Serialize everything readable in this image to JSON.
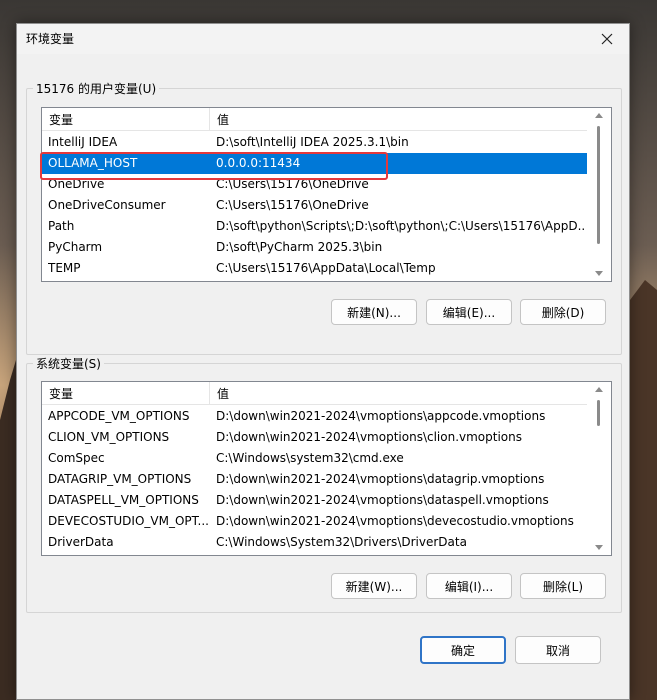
{
  "window": {
    "title": "环境变量",
    "close_icon": "close-icon"
  },
  "user_vars": {
    "group_label": "15176 的用户变量(U)",
    "columns": [
      "变量",
      "值"
    ],
    "rows": [
      {
        "name": "IntelliJ IDEA",
        "value": "D:\\soft\\IntelliJ IDEA 2025.3.1\\bin"
      },
      {
        "name": "OLLAMA_HOST",
        "value": "0.0.0.0:11434"
      },
      {
        "name": "OneDrive",
        "value": "C:\\Users\\15176\\OneDrive"
      },
      {
        "name": "OneDriveConsumer",
        "value": "C:\\Users\\15176\\OneDrive"
      },
      {
        "name": "Path",
        "value": "D:\\soft\\python\\Scripts\\;D:\\soft\\python\\;C:\\Users\\15176\\AppD..."
      },
      {
        "name": "PyCharm",
        "value": "D:\\soft\\PyCharm 2025.3\\bin"
      },
      {
        "name": "TEMP",
        "value": "C:\\Users\\15176\\AppData\\Local\\Temp"
      }
    ],
    "selected_row": "OLLAMA_HOST",
    "buttons": {
      "new": "新建(N)...",
      "edit": "编辑(E)...",
      "delete": "删除(D)"
    }
  },
  "system_vars": {
    "group_label": "系统变量(S)",
    "columns": [
      "变量",
      "值"
    ],
    "rows": [
      {
        "name": "APPCODE_VM_OPTIONS",
        "value": "D:\\down\\win2021-2024\\vmoptions\\appcode.vmoptions"
      },
      {
        "name": "CLION_VM_OPTIONS",
        "value": "D:\\down\\win2021-2024\\vmoptions\\clion.vmoptions"
      },
      {
        "name": "ComSpec",
        "value": "C:\\Windows\\system32\\cmd.exe"
      },
      {
        "name": "DATAGRIP_VM_OPTIONS",
        "value": "D:\\down\\win2021-2024\\vmoptions\\datagrip.vmoptions"
      },
      {
        "name": "DATASPELL_VM_OPTIONS",
        "value": "D:\\down\\win2021-2024\\vmoptions\\dataspell.vmoptions"
      },
      {
        "name": "DEVECOSTUDIO_VM_OPT...",
        "value": "D:\\down\\win2021-2024\\vmoptions\\devecostudio.vmoptions"
      },
      {
        "name": "DriverData",
        "value": "C:\\Windows\\System32\\Drivers\\DriverData"
      }
    ],
    "buttons": {
      "new": "新建(W)...",
      "edit": "编辑(I)...",
      "delete": "删除(L)"
    }
  },
  "footer": {
    "ok": "确定",
    "cancel": "取消"
  },
  "colors": {
    "selection": "#0078d7",
    "highlight_box": "#e4393c",
    "primary_border": "#2f74c7"
  }
}
